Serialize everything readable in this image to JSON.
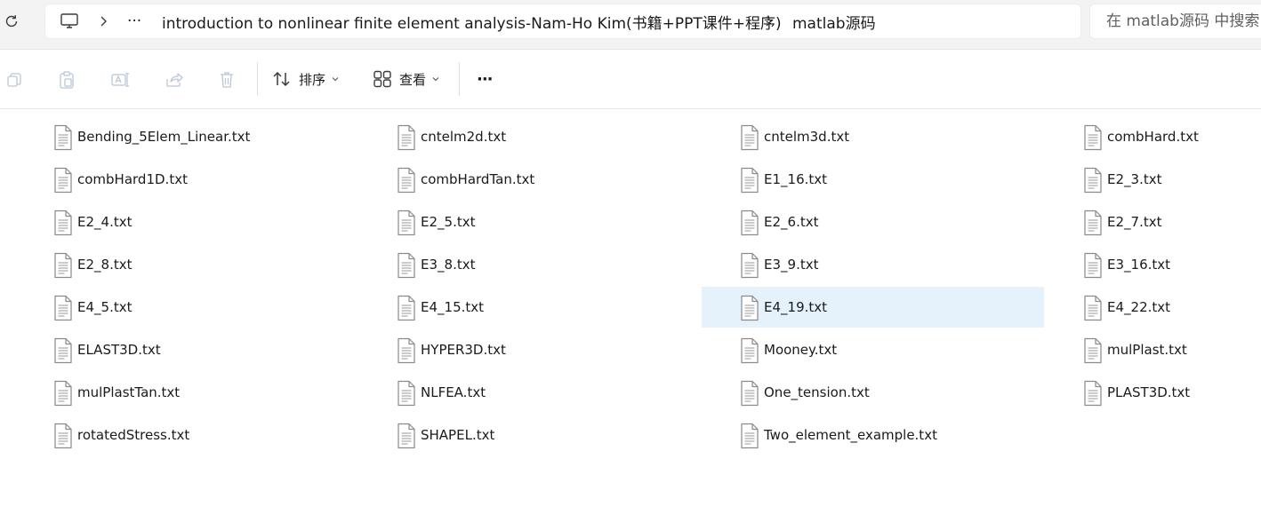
{
  "breadcrumb": {
    "ellipsis": "···",
    "folder": "introduction to nonlinear finite element analysis-Nam-Ho Kim(书籍+PPT课件+程序)",
    "current": "matlab源码"
  },
  "search": {
    "placeholder": "在 matlab源码 中搜索"
  },
  "toolbar": {
    "sort_label": "排序",
    "view_label": "查看",
    "more_label": "···"
  },
  "files": [
    "Bending_5Elem_Linear.txt",
    "cntelm2d.txt",
    "cntelm3d.txt",
    "combHard.txt",
    "combHard1D.txt",
    "combHardTan.txt",
    "E1_16.txt",
    "E2_3.txt",
    "E2_4.txt",
    "E2_5.txt",
    "E2_6.txt",
    "E2_7.txt",
    "E2_8.txt",
    "E3_8.txt",
    "E3_9.txt",
    "E3_16.txt",
    "E4_5.txt",
    "E4_15.txt",
    "E4_19.txt",
    "E4_22.txt",
    "ELAST3D.txt",
    "HYPER3D.txt",
    "Mooney.txt",
    "mulPlast.txt",
    "mulPlastTan.txt",
    "NLFEA.txt",
    "One_tension.txt",
    "PLAST3D.txt",
    "rotatedStress.txt",
    "SHAPEL.txt",
    "Two_element_example.txt"
  ],
  "selected_file": "E4_19.txt",
  "icons": {
    "refresh": "refresh-icon",
    "computer": "computer-icon",
    "copy": "copy-icon",
    "paste": "paste-icon",
    "rename": "rename-icon",
    "share": "share-icon",
    "delete": "delete-icon",
    "sort": "sort-icon",
    "view": "grid-view-icon",
    "file": "text-file-icon"
  },
  "colors": {
    "selection": "#e5f1fb",
    "addressbar_bg": "#f3f3f3"
  }
}
